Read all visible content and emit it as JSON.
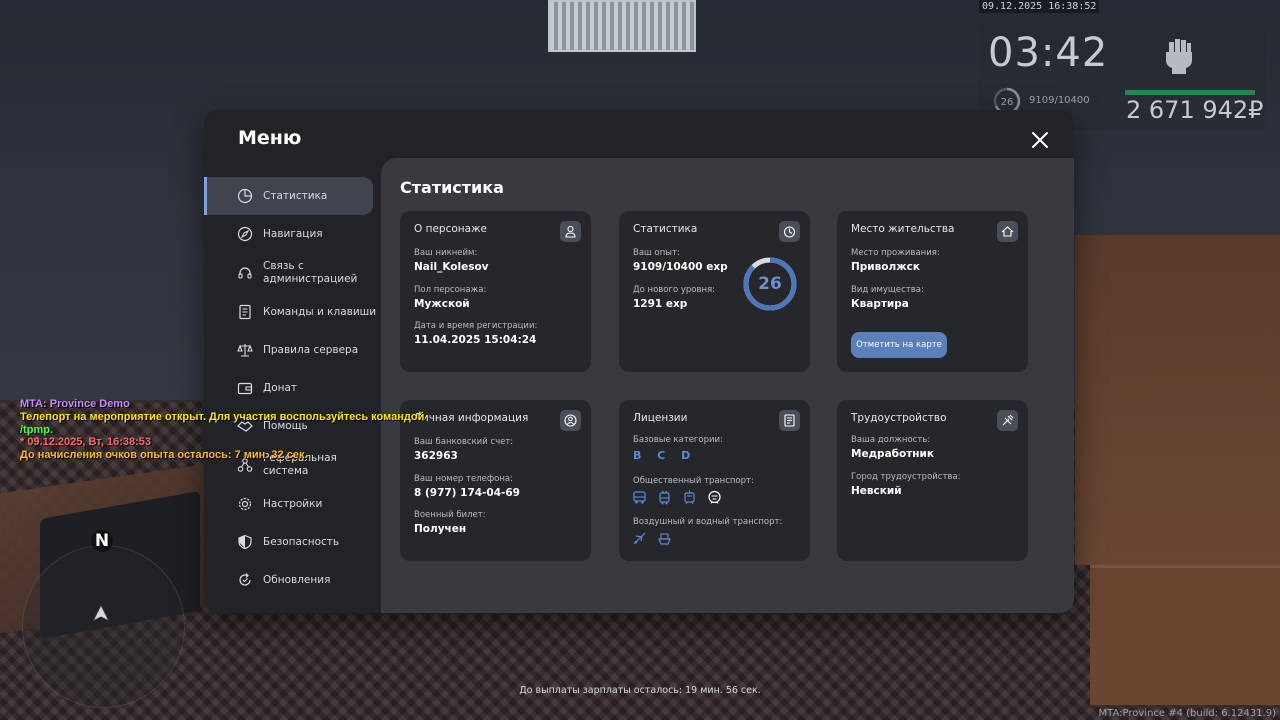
{
  "hud": {
    "datetime": "09.12.2025 16:38:52",
    "clock": "03:42",
    "level": "26",
    "exp": "9109/10400",
    "money": "2 671 942₽"
  },
  "chat": [
    "MTA: Province Demo",
    "Телепорт на мероприятие открыт. Для участия воспользуйтесь командой",
    "/tpmp.",
    "* 09.12.2025, Вт, 16:38:53",
    "До начисления очков опыта осталось: 7 мин. 32 сек."
  ],
  "radar": {
    "north": "N"
  },
  "footer": {
    "payout": "До выплаты зарплаты осталось: 19 мин. 56 сек.",
    "build": "MTA:Province #4 (build: 6.12431.9)"
  },
  "menu": {
    "title": "Меню",
    "sidebar": [
      {
        "label": "Статистика",
        "icon": "pie-chart-icon"
      },
      {
        "label": "Навигация",
        "icon": "compass-icon"
      },
      {
        "label": "Связь с администрацией",
        "icon": "headset-icon"
      },
      {
        "label": "Команды и клавиши",
        "icon": "document-icon"
      },
      {
        "label": "Правила сервера",
        "icon": "scales-icon"
      },
      {
        "label": "Донат",
        "icon": "wallet-icon"
      },
      {
        "label": "Помощь",
        "icon": "handshake-icon"
      },
      {
        "label": "Реферальная система",
        "icon": "referral-icon"
      },
      {
        "label": "Настройки",
        "icon": "gear-icon"
      },
      {
        "label": "Безопасность",
        "icon": "shield-icon"
      },
      {
        "label": "Обновления",
        "icon": "refresh-icon"
      }
    ],
    "active_index": 0
  },
  "stats": {
    "title": "Статистика",
    "character": {
      "title": "О персонаже",
      "nickname_label": "Ваш никнейм:",
      "nickname": "Nail_Kolesov",
      "gender_label": "Пол персонажа:",
      "gender": "Мужской",
      "reg_label": "Дата и время регистрации:",
      "reg": "11.04.2025 15:04:24"
    },
    "statistics": {
      "title": "Статистика",
      "exp_label": "Ваш опыт:",
      "exp": "9109/10400 exp",
      "next_label": "До нового уровня:",
      "next": "1291 exp",
      "level": "26",
      "level_progress": 0.876
    },
    "residence": {
      "title": "Место жительства",
      "place_label": "Место проживания:",
      "place": "Приволжск",
      "property_label": "Вид имущества:",
      "property": "Квартира",
      "map_button": "Отметить на карте"
    },
    "personal": {
      "title": "Личная информация",
      "bank_label": "Ваш банковский счет:",
      "bank": "362963",
      "phone_label": "Ваш номер телефона:",
      "phone": "8 (977) 174-04-69",
      "military_label": "Военный билет:",
      "military": "Получен"
    },
    "licenses": {
      "title": "Лицензии",
      "base_label": "Базовые категории:",
      "base": "B C D",
      "public_label": "Общественный транспорт:",
      "air_label": "Воздушный и водный транспорт:"
    },
    "employment": {
      "title": "Трудоустройство",
      "position_label": "Ваша должность:",
      "position": "Медработник",
      "city_label": "Город трудоустройства:",
      "city": "Невский"
    }
  },
  "colors": {
    "accent": "#5b7fbb",
    "ring": "#4f76b8",
    "category": "#5b8ad6",
    "panel": "#26272b",
    "content": "#383a3f",
    "window": "#222327"
  }
}
